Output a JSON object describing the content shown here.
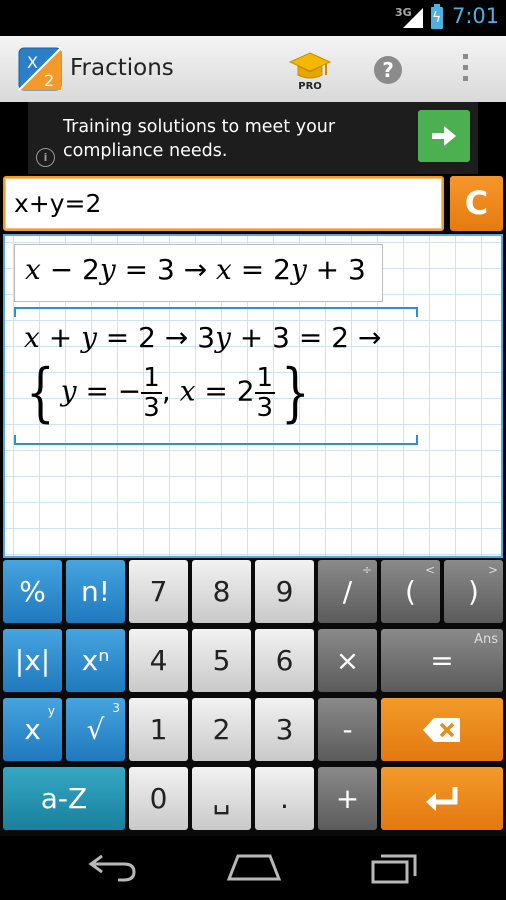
{
  "status_bar": {
    "network": "3G",
    "time": "7:01"
  },
  "app": {
    "title": "Fractions",
    "icon_top": "X",
    "icon_bottom": "2",
    "pro_label": "PRO"
  },
  "ad": {
    "text": "Training solutions to meet your compliance needs.",
    "info": "i"
  },
  "input": {
    "value": "x+y=2",
    "clear_label": "C"
  },
  "worksheet": {
    "eq1": {
      "lhs_var1": "x",
      "lhs_op": " − 2",
      "lhs_var2": "y",
      "lhs_rest": " = 3 ",
      "arrow": "→",
      "rhs_var1": " x",
      "rhs_mid": " = 2",
      "rhs_var2": "y",
      "rhs_rest": " + 3"
    },
    "eq2": {
      "x": "x",
      "op1": " + ",
      "y": "y",
      "rest1": " = 2 ",
      "arrow1": "→",
      "mid": " 3",
      "y2": "y",
      "rest2": " + 3 = 2 ",
      "arrow2": "→"
    },
    "solution": {
      "y_var": "y",
      "eq": " = −",
      "frac1_num": "1",
      "frac1_den": "3",
      "comma": ",",
      "x_var": " x",
      "eq2": " = 2",
      "frac2_num": "1",
      "frac2_den": "3",
      "open_brace": "{",
      "close_brace": "}"
    }
  },
  "keypad": {
    "rows": [
      [
        "%",
        "n!",
        "7",
        "8",
        "9",
        "/",
        "(",
        ")"
      ],
      [
        "|x|",
        "xⁿ",
        "4",
        "5",
        "6",
        "×",
        "="
      ],
      [
        "x",
        "√",
        "1",
        "2",
        "3",
        "-"
      ],
      [
        "a-Z",
        "0",
        "␣",
        ".",
        "+"
      ]
    ],
    "superscripts": {
      "div": "÷",
      "lt": "<",
      "gt": ">",
      "ans": "Ans",
      "x_y": "y",
      "root_3": "3"
    }
  }
}
